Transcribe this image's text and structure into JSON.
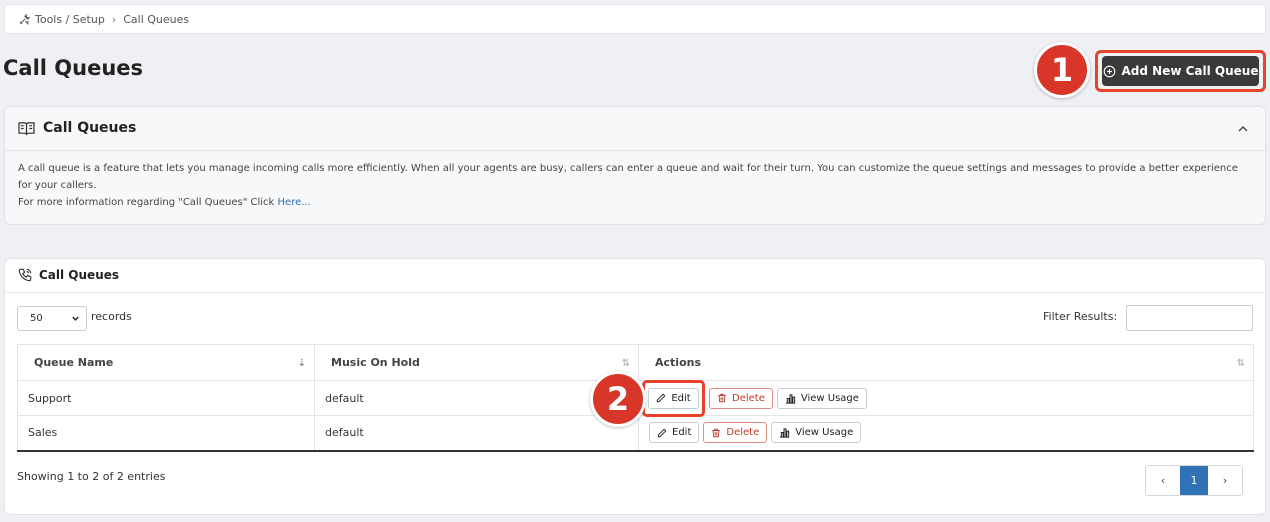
{
  "breadcrumb": {
    "parent": "Tools / Setup",
    "current": "Call Queues"
  },
  "page": {
    "title": "Call Queues"
  },
  "actions": {
    "add_label": "Add New Call Queue"
  },
  "annotations": {
    "badge1": "1",
    "badge2": "2"
  },
  "info": {
    "title": "Call Queues",
    "body": "A call queue is a feature that lets you manage incoming calls more efficiently. When all your agents are busy, callers can enter a queue and wait for their turn. You can customize the queue settings and messages to provide a better experience for your callers.",
    "more_prefix": "For more information regarding \"Call Queues\" Click",
    "more_link": "Here..."
  },
  "table": {
    "title": "Call Queues",
    "page_size": "50",
    "records_label": "records",
    "filter_label": "Filter Results:",
    "columns": [
      "Queue Name",
      "Music On Hold",
      "Actions"
    ],
    "rows": [
      {
        "name": "Support",
        "moh": "default"
      },
      {
        "name": "Sales",
        "moh": "default"
      }
    ],
    "row_actions": {
      "edit": "Edit",
      "delete": "Delete",
      "usage": "View Usage"
    },
    "showing": "Showing 1 to 2 of 2 entries",
    "pager": {
      "prev": "‹",
      "current": "1",
      "next": "›"
    }
  },
  "colors": {
    "accent": "#e8412c",
    "primary": "#2f72b5",
    "danger": "#c0392b",
    "dark_button": "#3a3a3a"
  }
}
